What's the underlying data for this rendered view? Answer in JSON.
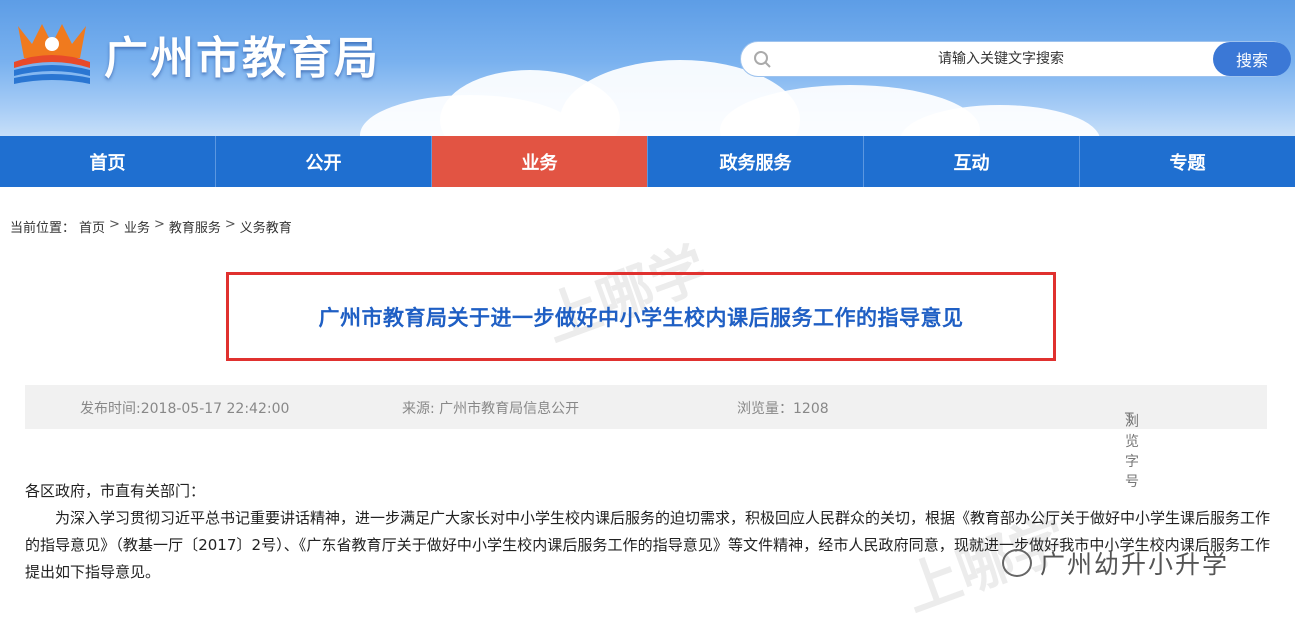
{
  "header": {
    "site_title": "广州市教育局",
    "search_placeholder": "请输入关键文字搜索",
    "search_button": "搜索"
  },
  "nav": {
    "items": [
      {
        "label": "首页"
      },
      {
        "label": "公开"
      },
      {
        "label": "业务"
      },
      {
        "label": "政务服务"
      },
      {
        "label": "互动"
      },
      {
        "label": "专题"
      }
    ],
    "active": "业务"
  },
  "breadcrumb": {
    "prefix": "当前位置：",
    "items": [
      "首页",
      "业务",
      "教育服务",
      "义务教育"
    ],
    "separator": ">"
  },
  "article": {
    "title": "广州市教育局关于进一步做好中小学生校内课后服务工作的指导意见",
    "publish_time": "发布时间:2018-05-17 22:42:00",
    "source": "来源: 广州市教育局信息公开",
    "views": "浏览量：1208",
    "font_tool_icon": "T",
    "font_tool_label": "浏览字号",
    "salutation": "各区政府，市直有关部门：",
    "paragraph": "为深入学习贯彻习近平总书记重要讲话精神，进一步满足广大家长对中小学生校内课后服务的迫切需求，积极回应人民群众的关切，根据《教育部办公厅关于做好中小学生课后服务工作的指导意见》（教基一厅〔2017〕2号）、《广东省教育厅关于做好中小学生校内课后服务工作的指导意见》等文件精神，经市人民政府同意，现就进一步做好我市中小学生校内课后服务工作提出如下指导意见。"
  },
  "watermarks": {
    "brand": "上哪学",
    "account_label": "广州幼升小升学"
  },
  "colors": {
    "header_sky": "#5d9de6",
    "nav_blue": "#1f6fd0",
    "nav_active": "#e25443",
    "title_blue": "#1f5fc4",
    "highlight_border": "#e0312f"
  }
}
